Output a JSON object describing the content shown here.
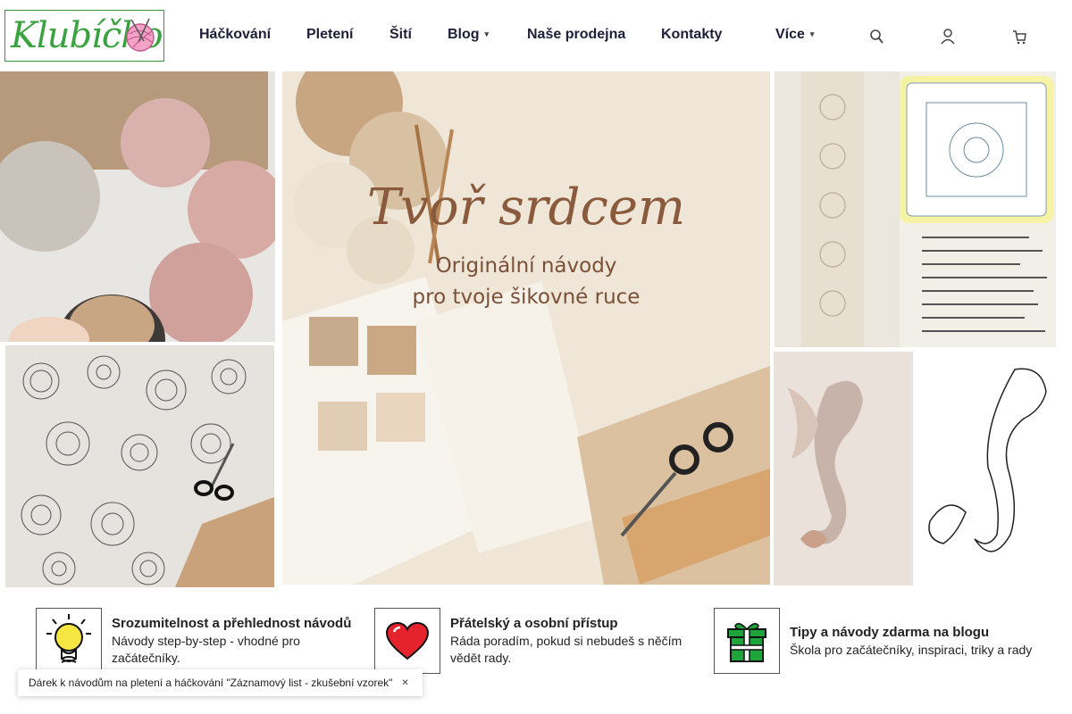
{
  "header": {
    "logo_text": "Klubíčko",
    "nav": [
      {
        "label": "Háčkování",
        "has_dropdown": false
      },
      {
        "label": "Pletení",
        "has_dropdown": false
      },
      {
        "label": "Šití",
        "has_dropdown": false
      },
      {
        "label": "Blog",
        "has_dropdown": true
      },
      {
        "label": "Naše prodejna",
        "has_dropdown": false
      },
      {
        "label": "Kontakty",
        "has_dropdown": false
      },
      {
        "label": "Více",
        "has_dropdown": true
      }
    ],
    "caret": "▾",
    "icons": [
      "search-icon",
      "user-icon",
      "cart-icon"
    ]
  },
  "hero": {
    "title": "Tvoř srdcem",
    "subtitle_line1": "Originální návody",
    "subtitle_line2": "pro tvoje šikovné ruce"
  },
  "features": [
    {
      "icon": "lightbulb-icon",
      "title": "Srozumitelnost a přehlednost návodů",
      "text": "Návody step-by-step - vhodné pro začátečníky."
    },
    {
      "icon": "heart-icon",
      "title": "Přátelský a osobní přístup",
      "text": "Ráda poradím, pokud si nebudeš s něčím vědět rady."
    },
    {
      "icon": "gift-icon",
      "title": "Tipy a návody zdarma na blogu",
      "text": "Škola pro začátečníky, inspiraci, triky a rady"
    }
  ],
  "gift_bar": {
    "text": "Dárek k návodům na pletení a háčkování \"Záznamový list - zkušební vzorek\"",
    "close_icon": "close-icon"
  },
  "colors": {
    "logo_green": "#3aa23f",
    "nav_text": "#1e1e3a",
    "hero_text": "#8a5a3c",
    "heart_red": "#e4232c",
    "gift_green": "#1fa33b",
    "bulb_yellow": "#f5e642"
  }
}
